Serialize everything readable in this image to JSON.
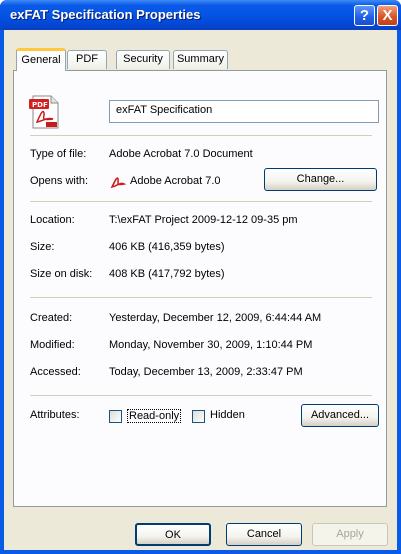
{
  "window": {
    "title": "exFAT Specification Properties"
  },
  "title_buttons": {
    "help": "?",
    "close": "X"
  },
  "tabs": [
    {
      "label": "General",
      "active": true
    },
    {
      "label": "PDF",
      "active": false
    },
    {
      "label": "Security",
      "active": false
    },
    {
      "label": "Summary",
      "active": false
    }
  ],
  "general": {
    "file_name": "exFAT Specification",
    "type_label": "Type of file:",
    "type_value": "Adobe Acrobat 7.0 Document",
    "opens_label": "Opens with:",
    "opens_value": "Adobe Acrobat 7.0",
    "change_button": "Change...",
    "location_label": "Location:",
    "location_value": "T:\\exFAT Project 2009-12-12 09-35 pm",
    "size_label": "Size:",
    "size_value": "406 KB (416,359 bytes)",
    "size_disk_label": "Size on disk:",
    "size_disk_value": "408 KB (417,792 bytes)",
    "created_label": "Created:",
    "created_value": "Yesterday, December 12, 2009, 6:44:44 AM",
    "modified_label": "Modified:",
    "modified_value": "Monday, November 30, 2009, 1:10:44 PM",
    "accessed_label": "Accessed:",
    "accessed_value": "Today, December 13, 2009, 2:33:47 PM",
    "attributes_label": "Attributes:",
    "readonly_label": "Read-only",
    "readonly_checked": false,
    "hidden_label": "Hidden",
    "hidden_checked": false,
    "advanced_button": "Advanced..."
  },
  "footer": {
    "ok": "OK",
    "cancel": "Cancel",
    "apply": "Apply",
    "apply_enabled": false
  },
  "icons": {
    "file_icon": "pdf-file-icon",
    "app_icon": "acrobat-icon"
  },
  "colors": {
    "title_bar": "#0554e3",
    "tab_highlight": "#ffc83c",
    "dialog_bg": "#ece9d8"
  }
}
